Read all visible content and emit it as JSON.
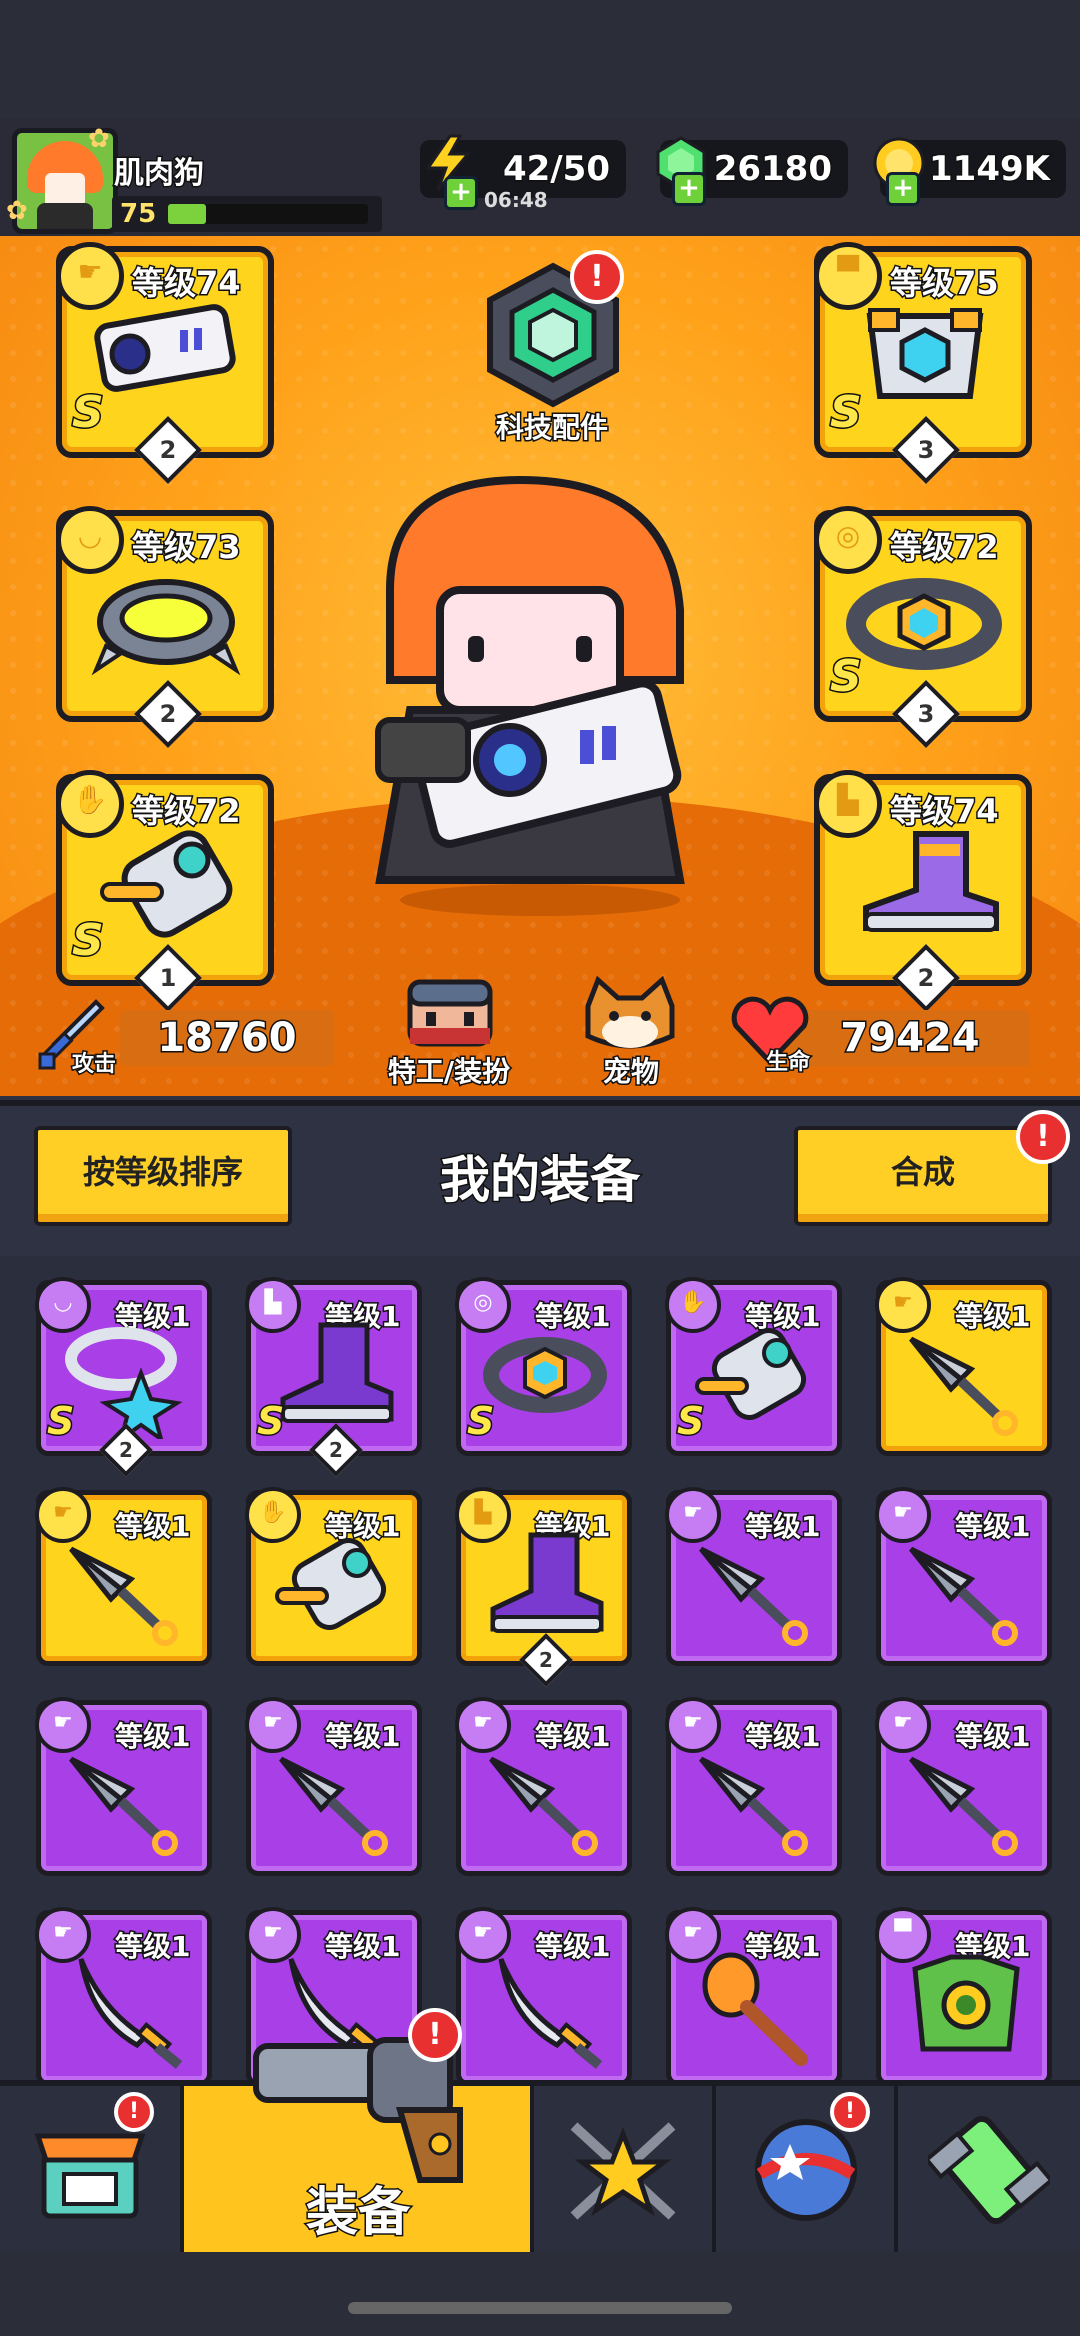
{
  "player": {
    "name": "肌肉狗",
    "level": "75",
    "xp_fraction": 0.19
  },
  "resources": {
    "energy": "42/50",
    "energy_timer": "06:48",
    "gems": "26180",
    "gold": "1149K"
  },
  "tech_parts": {
    "label": "科技配件",
    "badge": "!"
  },
  "equipped": [
    {
      "slot": "weapon",
      "level_label": "等级74",
      "grade": "S",
      "count": "2"
    },
    {
      "slot": "armor",
      "level_label": "等级75",
      "grade": "S",
      "count": "3"
    },
    {
      "slot": "necklace",
      "level_label": "等级73",
      "grade": "",
      "count": "2"
    },
    {
      "slot": "belt",
      "level_label": "等级72",
      "grade": "S",
      "count": "3"
    },
    {
      "slot": "gloves",
      "level_label": "等级72",
      "grade": "S",
      "count": "1"
    },
    {
      "slot": "boots",
      "level_label": "等级74",
      "grade": "",
      "count": "2"
    }
  ],
  "stats": {
    "attack_label": "攻击",
    "attack": "18760",
    "hp_label": "生命",
    "hp": "79424"
  },
  "character_labels": {
    "agent": "特工/装扮",
    "pet": "宠物"
  },
  "section": {
    "sort_button": "按等级排序",
    "title": "我的装备",
    "combine_button": "合成",
    "combine_badge": "!"
  },
  "inventory": [
    {
      "type": "necklace",
      "rarity": "purple",
      "level_label": "等级1",
      "grade": "S",
      "count": "2"
    },
    {
      "type": "boots",
      "rarity": "purple",
      "level_label": "等级1",
      "grade": "S",
      "count": "2"
    },
    {
      "type": "belt",
      "rarity": "purple",
      "level_label": "等级1",
      "grade": "S",
      "count": ""
    },
    {
      "type": "gloves",
      "rarity": "purple",
      "level_label": "等级1",
      "grade": "S",
      "count": ""
    },
    {
      "type": "kunai",
      "rarity": "yellow",
      "level_label": "等级1",
      "grade": "",
      "count": ""
    },
    {
      "type": "kunai",
      "rarity": "yellow",
      "level_label": "等级1",
      "grade": "",
      "count": ""
    },
    {
      "type": "gloves",
      "rarity": "yellow",
      "level_label": "等级1",
      "grade": "",
      "count": ""
    },
    {
      "type": "boots",
      "rarity": "yellow",
      "level_label": "等级1",
      "grade": "",
      "count": "2"
    },
    {
      "type": "kunai",
      "rarity": "purple",
      "level_label": "等级1",
      "grade": "",
      "count": ""
    },
    {
      "type": "kunai",
      "rarity": "purple",
      "level_label": "等级1",
      "grade": "",
      "count": ""
    },
    {
      "type": "kunai",
      "rarity": "purple",
      "level_label": "等级1",
      "grade": "",
      "count": ""
    },
    {
      "type": "kunai",
      "rarity": "purple",
      "level_label": "等级1",
      "grade": "",
      "count": ""
    },
    {
      "type": "kunai",
      "rarity": "purple",
      "level_label": "等级1",
      "grade": "",
      "count": ""
    },
    {
      "type": "kunai",
      "rarity": "purple",
      "level_label": "等级1",
      "grade": "",
      "count": ""
    },
    {
      "type": "kunai",
      "rarity": "purple",
      "level_label": "等级1",
      "grade": "",
      "count": ""
    },
    {
      "type": "katana",
      "rarity": "purple",
      "level_label": "等级1",
      "grade": "",
      "count": ""
    },
    {
      "type": "katana",
      "rarity": "purple",
      "level_label": "等级1",
      "grade": "",
      "count": ""
    },
    {
      "type": "katana",
      "rarity": "purple",
      "level_label": "等级1",
      "grade": "",
      "count": ""
    },
    {
      "type": "bat",
      "rarity": "purple",
      "level_label": "等级1",
      "grade": "",
      "count": ""
    },
    {
      "type": "armor",
      "rarity": "purple",
      "level_label": "等级1",
      "grade": "",
      "count": ""
    }
  ],
  "nav": {
    "tabs": [
      {
        "name": "shop",
        "badge": "!"
      },
      {
        "name": "equipment",
        "label": "装备",
        "badge": "!",
        "active": true
      },
      {
        "name": "talent"
      },
      {
        "name": "world",
        "badge": "!"
      },
      {
        "name": "lab"
      }
    ]
  },
  "colors": {
    "accent": "#ffc41e",
    "purple_rarity": "#a93fe6",
    "yellow_rarity": "#ffd41c",
    "badge": "#e83030"
  }
}
